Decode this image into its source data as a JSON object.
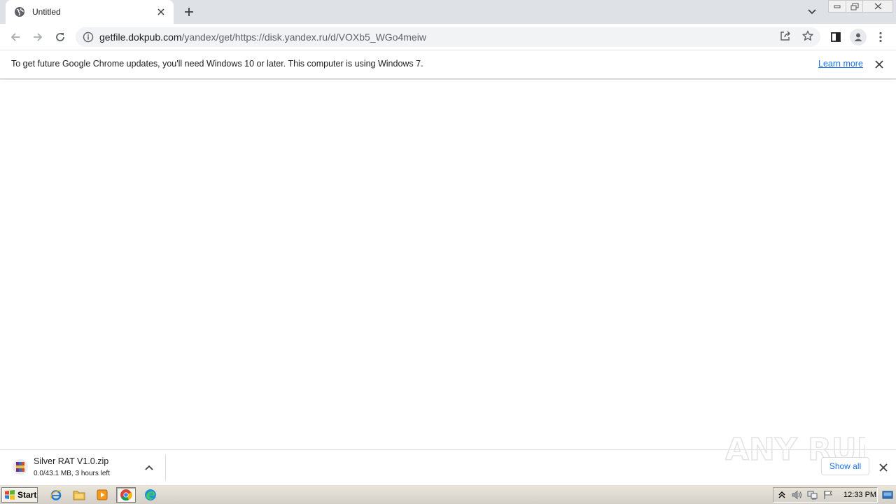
{
  "tab": {
    "title": "Untitled"
  },
  "omnibox": {
    "url_host": "getfile.dokpub.com",
    "url_path": "/yandex/get/https://disk.yandex.ru/d/VOXb5_WGo4meiw"
  },
  "infobar": {
    "message": "To get future Google Chrome updates, you'll need Windows 10 or later. This computer is using Windows 7.",
    "learn_more": "Learn more"
  },
  "download": {
    "file_name": "Silver RAT V1.0.zip",
    "status": "0.0/43.1 MB, 3 hours left",
    "show_all": "Show all"
  },
  "watermark": {
    "text": "ANY RUN"
  },
  "taskbar": {
    "start_label": "Start",
    "clock": "12:33 PM"
  },
  "colors": {
    "accent": "#1a73e8",
    "tabstrip": "#dee1e6",
    "omnibox": "#f1f3f4",
    "taskbar": "#d4d0c8"
  }
}
